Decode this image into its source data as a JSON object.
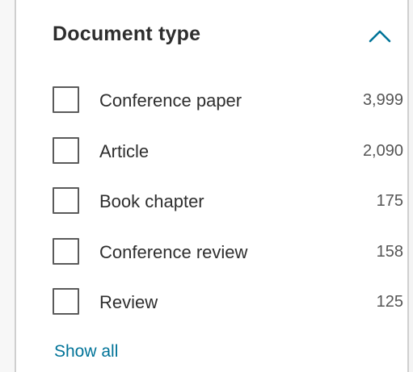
{
  "filter": {
    "title": "Document type",
    "collapse_icon": "chevron-up-icon",
    "accent_color": "#007398",
    "items": [
      {
        "label": "Conference paper",
        "count": "3,999"
      },
      {
        "label": "Article",
        "count": "2,090"
      },
      {
        "label": "Book chapter",
        "count": "175"
      },
      {
        "label": "Conference review",
        "count": "158"
      },
      {
        "label": "Review",
        "count": "125"
      }
    ],
    "show_all_label": "Show all"
  }
}
